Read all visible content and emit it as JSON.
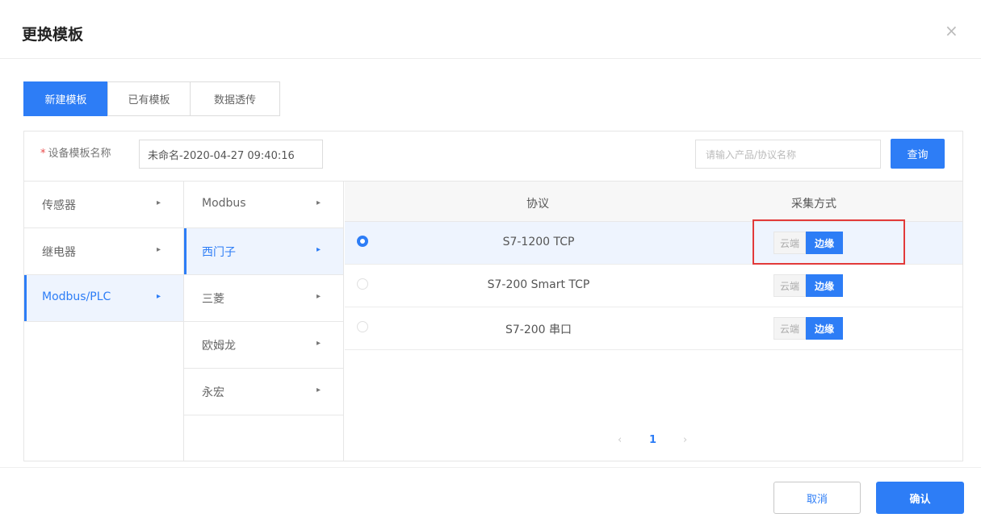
{
  "dialog": {
    "title": "更换模板",
    "close_glyph": "×"
  },
  "tabs": [
    {
      "label": "新建模板",
      "active": true
    },
    {
      "label": "已有模板",
      "active": false
    },
    {
      "label": "数据透传",
      "active": false
    }
  ],
  "form": {
    "required_mark": "*",
    "name_label": "设备模板名称",
    "name_value": "未命名-2020-04-27 09:40:16",
    "search_placeholder": "请输入产品/协议名称",
    "query_button": "查询"
  },
  "categories": [
    {
      "label": "传感器",
      "active": false
    },
    {
      "label": "继电器",
      "active": false
    },
    {
      "label": "Modbus/PLC",
      "active": true
    }
  ],
  "vendors": [
    {
      "label": "Modbus",
      "active": false
    },
    {
      "label": "西门子",
      "active": true
    },
    {
      "label": "三菱",
      "active": false
    },
    {
      "label": "欧姆龙",
      "active": false
    },
    {
      "label": "永宏",
      "active": false
    }
  ],
  "arrow_glyph": "▸",
  "table": {
    "headers": {
      "protocol": "协议",
      "method": "采集方式"
    },
    "rows": [
      {
        "protocol": "S7-1200 TCP",
        "selected": true,
        "cloud_label": "云端",
        "edge_label": "边缘"
      },
      {
        "protocol": "S7-200 Smart TCP",
        "selected": false,
        "cloud_label": "云端",
        "edge_label": "边缘"
      },
      {
        "protocol": "S7-200 串口",
        "selected": false,
        "cloud_label": "云端",
        "edge_label": "边缘"
      }
    ]
  },
  "pagination": {
    "prev": "‹",
    "current": "1",
    "next": "›"
  },
  "footer": {
    "cancel": "取消",
    "confirm": "确认"
  },
  "colors": {
    "accent": "#2d7df6",
    "highlight_box": "#e23a3a"
  }
}
